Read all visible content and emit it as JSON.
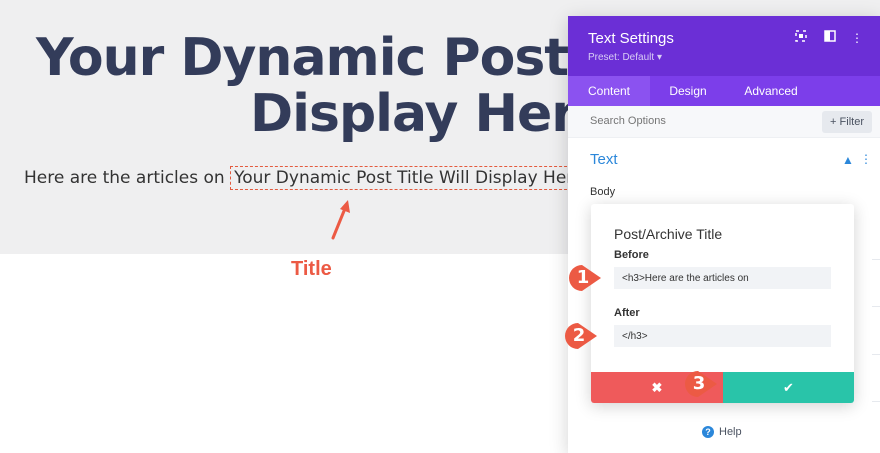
{
  "page": {
    "heading_line1": "Your Dynamic Post T",
    "heading_line2": "Display Here",
    "intro_prefix": "Here are the articles on",
    "intro_dynamic": "Your Dynamic Post Title Will Display Here",
    "annotation_label": "Title"
  },
  "panel": {
    "title": "Text Settings",
    "preset": "Preset: Default",
    "tabs": [
      {
        "label": "Content",
        "active": true
      },
      {
        "label": "Design",
        "active": false
      },
      {
        "label": "Advanced",
        "active": false
      }
    ],
    "search_placeholder": "Search Options",
    "filter_label": "Filter",
    "section_title": "Text",
    "body_label": "Body",
    "help_label": "Help"
  },
  "popup": {
    "title": "Post/Archive Title",
    "before_label": "Before",
    "before_value": "<h3>Here are the articles on",
    "after_label": "After",
    "after_value": "</h3>"
  },
  "markers": [
    "1",
    "2",
    "3"
  ],
  "colors": {
    "header_purple": "#6b2fd6",
    "tab_purple": "#7c3eea",
    "accent_blue": "#2b87da",
    "cancel_red": "#ef5a5b",
    "confirm_green": "#29c4a9",
    "annotation_red": "#ec5a44"
  },
  "icons": {
    "cancel": "close-icon",
    "confirm": "check-icon",
    "help": "help-icon",
    "filter": "plus-icon"
  }
}
